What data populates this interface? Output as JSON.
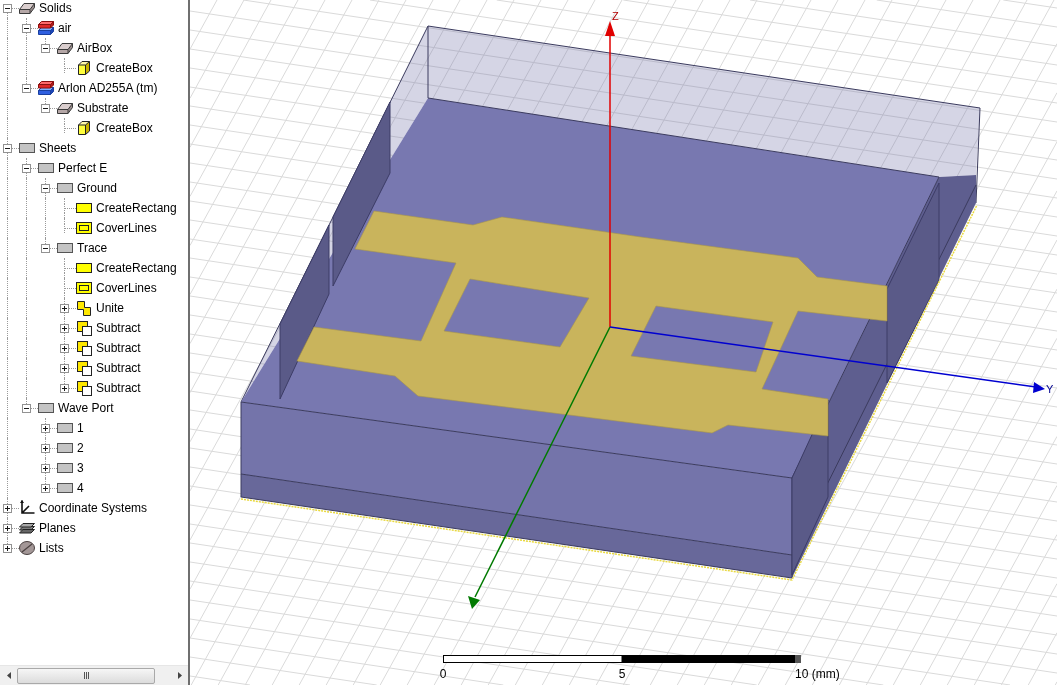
{
  "model_tree": {
    "items": [
      {
        "label": "Solids",
        "kind": "solid",
        "expanded": true,
        "children": [
          {
            "label": "air",
            "kind": "material",
            "expanded": true,
            "children": [
              {
                "label": "AirBox",
                "kind": "solid",
                "expanded": true,
                "children": [
                  {
                    "label": "CreateBox",
                    "kind": "createbox"
                  }
                ]
              }
            ]
          },
          {
            "label": "Arlon AD255A (tm)",
            "kind": "material",
            "expanded": true,
            "children": [
              {
                "label": "Substrate",
                "kind": "solid",
                "expanded": true,
                "children": [
                  {
                    "label": "CreateBox",
                    "kind": "createbox"
                  }
                ]
              }
            ]
          }
        ]
      },
      {
        "label": "Sheets",
        "kind": "sheet",
        "expanded": true,
        "children": [
          {
            "label": "Perfect E",
            "kind": "sheet",
            "expanded": true,
            "children": [
              {
                "label": "Ground",
                "kind": "sheet",
                "expanded": true,
                "children": [
                  {
                    "label": "CreateRectang",
                    "kind": "rectangle"
                  },
                  {
                    "label": "CoverLines",
                    "kind": "cover"
                  }
                ]
              },
              {
                "label": "Trace",
                "kind": "sheet",
                "expanded": true,
                "children": [
                  {
                    "label": "CreateRectang",
                    "kind": "rectangle"
                  },
                  {
                    "label": "CoverLines",
                    "kind": "cover"
                  },
                  {
                    "label": "Unite",
                    "kind": "unite",
                    "expanded": false
                  },
                  {
                    "label": "Subtract",
                    "kind": "subtract",
                    "expanded": false
                  },
                  {
                    "label": "Subtract",
                    "kind": "subtract",
                    "expanded": false
                  },
                  {
                    "label": "Subtract",
                    "kind": "subtract",
                    "expanded": false
                  },
                  {
                    "label": "Subtract",
                    "kind": "subtract",
                    "expanded": false
                  }
                ]
              }
            ]
          },
          {
            "label": "Wave Port",
            "kind": "sheet",
            "expanded": true,
            "children": [
              {
                "label": "1",
                "kind": "sheet",
                "expanded": false
              },
              {
                "label": "2",
                "kind": "sheet",
                "expanded": false
              },
              {
                "label": "3",
                "kind": "sheet",
                "expanded": false
              },
              {
                "label": "4",
                "kind": "sheet",
                "expanded": false
              }
            ]
          }
        ]
      },
      {
        "label": "Coordinate Systems",
        "kind": "coordinates",
        "expanded": false
      },
      {
        "label": "Planes",
        "kind": "planes",
        "expanded": false
      },
      {
        "label": "Lists",
        "kind": "lists",
        "expanded": false
      }
    ]
  },
  "view": {
    "z_axis": {
      "label": "Z"
    },
    "y_axis": {
      "label": "Y"
    },
    "scale_bar": {
      "labels": [
        "0",
        "5",
        "10 (mm)"
      ]
    }
  }
}
